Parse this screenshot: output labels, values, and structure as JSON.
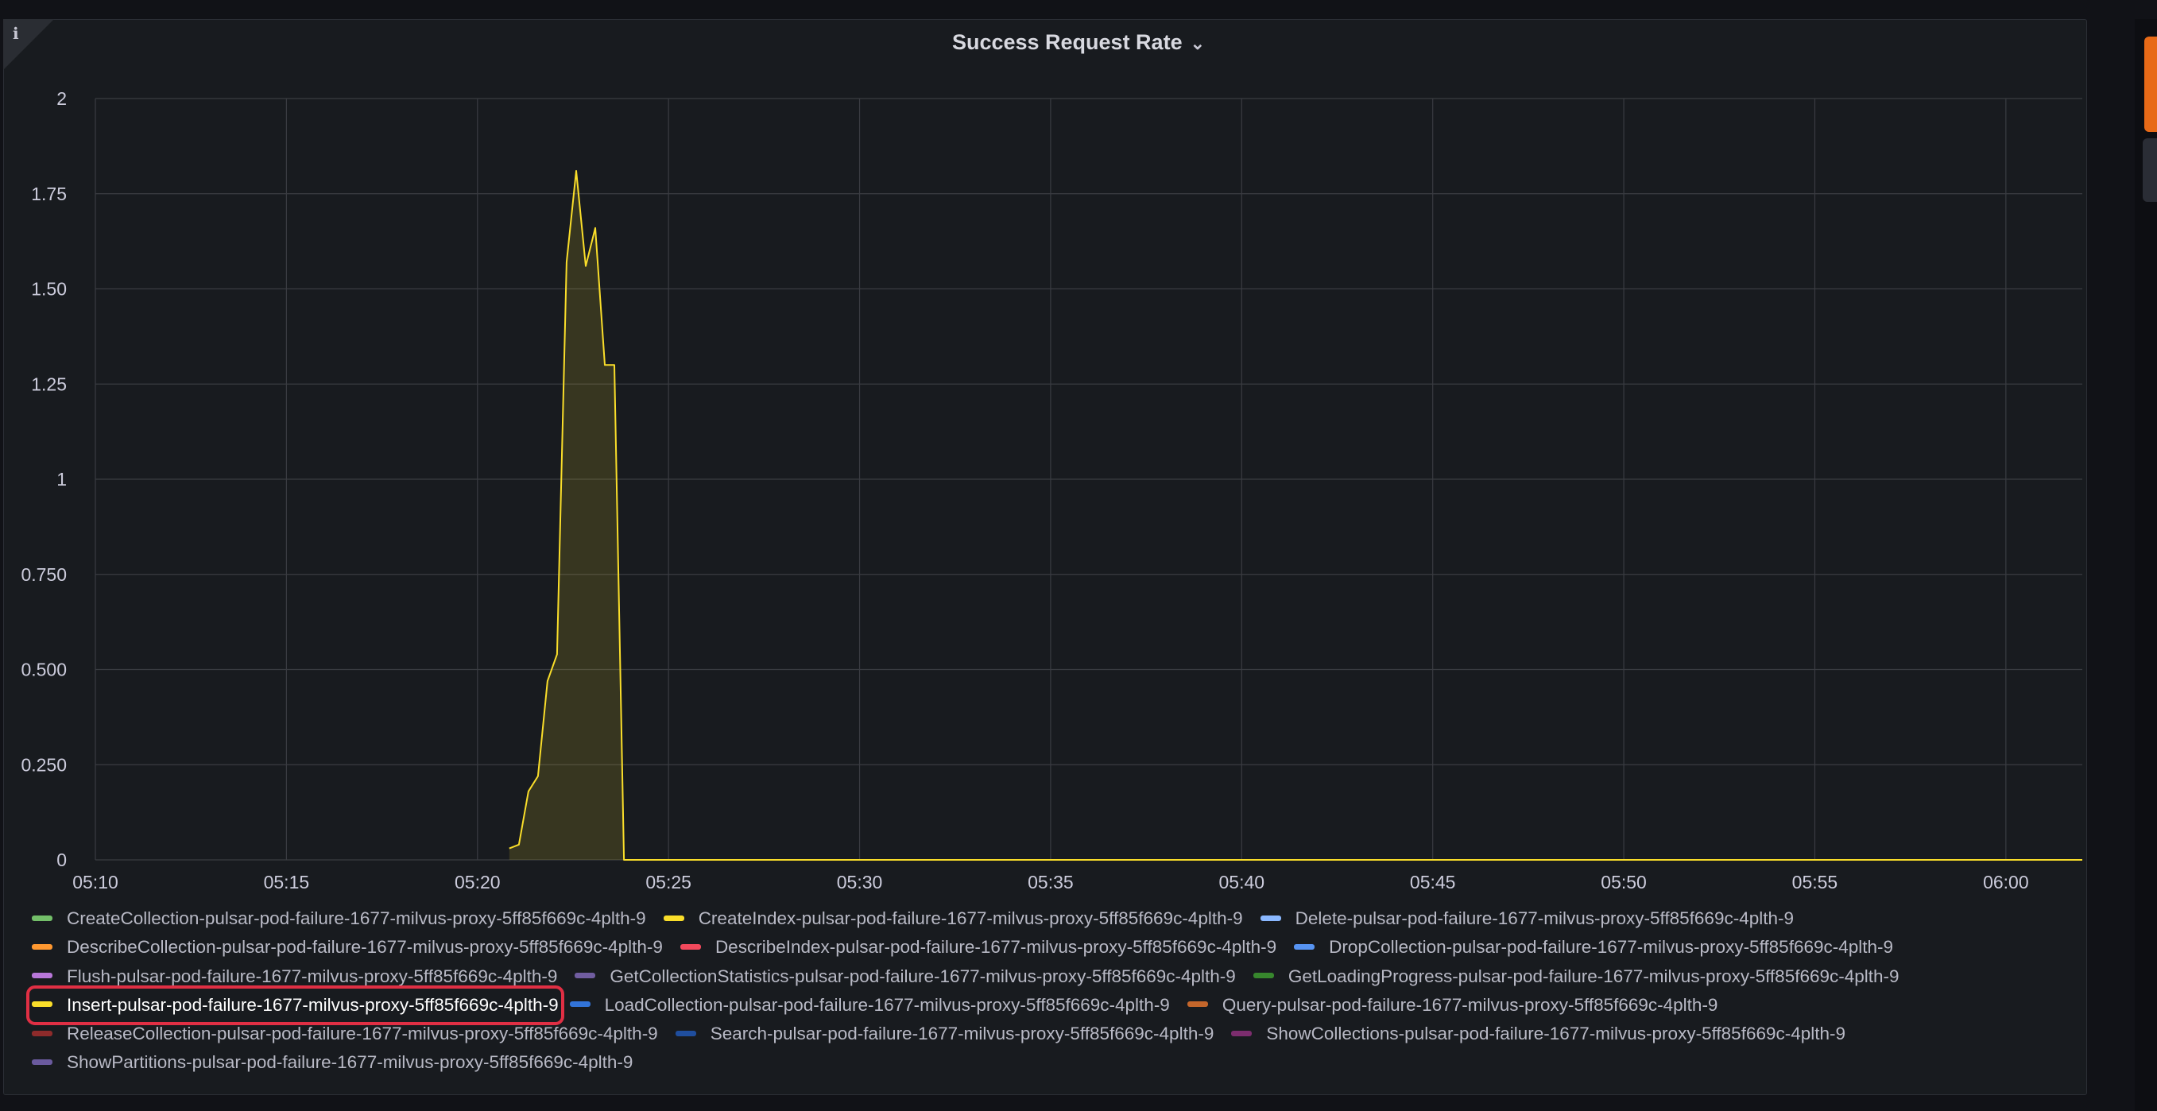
{
  "panel": {
    "title": "Success Request Rate",
    "info_icon": "info-icon",
    "title_chevron": "chevron-down-icon"
  },
  "colors": {
    "background": "#181b1f",
    "grid": "#3a3c42",
    "series_line": "#fade2a",
    "series_fill": "#fade2a",
    "highlight_border": "#e02f44"
  },
  "chart_data": {
    "type": "line",
    "x_ticks": [
      "05:10",
      "05:15",
      "05:20",
      "05:25",
      "05:30",
      "05:35",
      "05:40",
      "05:45",
      "05:50",
      "05:55",
      "06:00"
    ],
    "y_ticks": [
      "0",
      "0.250",
      "0.500",
      "0.750",
      "1",
      "1.25",
      "1.50",
      "1.75",
      "2"
    ],
    "xlim": [
      "05:10",
      "06:02"
    ],
    "ylim": [
      0,
      2
    ],
    "grid": true,
    "legend_placement": "bottom",
    "series": [
      {
        "name": "Insert-pulsar-pod-failure-1677-milvus-proxy-5ff85f669c-4plth-9",
        "color": "#fade2a",
        "fill": true,
        "points": [
          [
            "05:20:50",
            0.03
          ],
          [
            "05:21:05",
            0.04
          ],
          [
            "05:21:20",
            0.18
          ],
          [
            "05:21:35",
            0.22
          ],
          [
            "05:21:50",
            0.47
          ],
          [
            "05:22:05",
            0.54
          ],
          [
            "05:22:20",
            1.57
          ],
          [
            "05:22:35",
            1.81
          ],
          [
            "05:22:50",
            1.56
          ],
          [
            "05:23:05",
            1.66
          ],
          [
            "05:23:20",
            1.3
          ],
          [
            "05:23:35",
            1.3
          ],
          [
            "05:23:50",
            0.0
          ],
          [
            "06:02:00",
            0.0
          ]
        ]
      }
    ]
  },
  "legend": {
    "rows": [
      [
        {
          "label": "CreateCollection-pulsar-pod-failure-1677-milvus-proxy-5ff85f669c-4plth-9",
          "color": "#73bf69"
        },
        {
          "label": "CreateIndex-pulsar-pod-failure-1677-milvus-proxy-5ff85f669c-4plth-9",
          "color": "#fade2a"
        },
        {
          "label": "Delete-pulsar-pod-failure-1677-milvus-proxy-5ff85f669c-4plth-9",
          "color": "#8ab8ff"
        }
      ],
      [
        {
          "label": "DescribeCollection-pulsar-pod-failure-1677-milvus-proxy-5ff85f669c-4plth-9",
          "color": "#ff9830"
        },
        {
          "label": "DescribeIndex-pulsar-pod-failure-1677-milvus-proxy-5ff85f669c-4plth-9",
          "color": "#f2495c"
        },
        {
          "label": "DropCollection-pulsar-pod-failure-1677-milvus-proxy-5ff85f669c-4plth-9",
          "color": "#5794f2"
        }
      ],
      [
        {
          "label": "Flush-pulsar-pod-failure-1677-milvus-proxy-5ff85f669c-4plth-9",
          "color": "#b877d9"
        },
        {
          "label": "GetCollectionStatistics-pulsar-pod-failure-1677-milvus-proxy-5ff85f669c-4plth-9",
          "color": "#705da0"
        },
        {
          "label": "GetLoadingProgress-pulsar-pod-failure-1677-milvus-proxy-5ff85f669c-4plth-9",
          "color": "#37872d"
        }
      ],
      [
        {
          "label": "Insert-pulsar-pod-failure-1677-milvus-proxy-5ff85f669c-4plth-9",
          "color": "#fade2a",
          "highlighted": true
        },
        {
          "label": "LoadCollection-pulsar-pod-failure-1677-milvus-proxy-5ff85f669c-4plth-9",
          "color": "#3274d9"
        },
        {
          "label": "Query-pulsar-pod-failure-1677-milvus-proxy-5ff85f669c-4plth-9",
          "color": "#c4662b"
        }
      ],
      [
        {
          "label": "ReleaseCollection-pulsar-pod-failure-1677-milvus-proxy-5ff85f669c-4plth-9",
          "color": "#8e2b2b"
        },
        {
          "label": "Search-pulsar-pod-failure-1677-milvus-proxy-5ff85f669c-4plth-9",
          "color": "#1f4e9e"
        },
        {
          "label": "ShowCollections-pulsar-pod-failure-1677-milvus-proxy-5ff85f669c-4plth-9",
          "color": "#7c2d6e"
        }
      ],
      [
        {
          "label": "ShowPartitions-pulsar-pod-failure-1677-milvus-proxy-5ff85f669c-4plth-9",
          "color": "#6a5a9e"
        }
      ]
    ]
  }
}
